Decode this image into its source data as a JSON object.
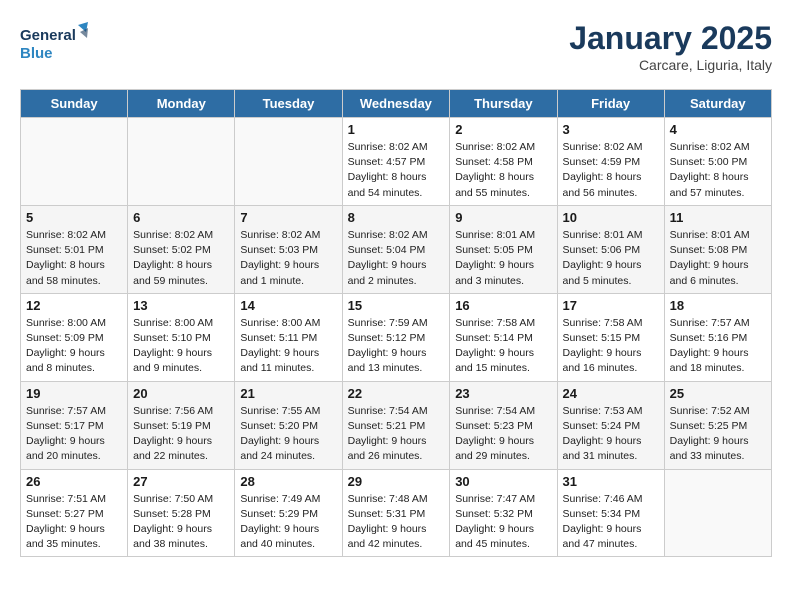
{
  "logo": {
    "line1": "General",
    "line2": "Blue"
  },
  "title": "January 2025",
  "subtitle": "Carcare, Liguria, Italy",
  "weekdays": [
    "Sunday",
    "Monday",
    "Tuesday",
    "Wednesday",
    "Thursday",
    "Friday",
    "Saturday"
  ],
  "weeks": [
    [
      {
        "day": "",
        "info": ""
      },
      {
        "day": "",
        "info": ""
      },
      {
        "day": "",
        "info": ""
      },
      {
        "day": "1",
        "info": "Sunrise: 8:02 AM\nSunset: 4:57 PM\nDaylight: 8 hours\nand 54 minutes."
      },
      {
        "day": "2",
        "info": "Sunrise: 8:02 AM\nSunset: 4:58 PM\nDaylight: 8 hours\nand 55 minutes."
      },
      {
        "day": "3",
        "info": "Sunrise: 8:02 AM\nSunset: 4:59 PM\nDaylight: 8 hours\nand 56 minutes."
      },
      {
        "day": "4",
        "info": "Sunrise: 8:02 AM\nSunset: 5:00 PM\nDaylight: 8 hours\nand 57 minutes."
      }
    ],
    [
      {
        "day": "5",
        "info": "Sunrise: 8:02 AM\nSunset: 5:01 PM\nDaylight: 8 hours\nand 58 minutes."
      },
      {
        "day": "6",
        "info": "Sunrise: 8:02 AM\nSunset: 5:02 PM\nDaylight: 8 hours\nand 59 minutes."
      },
      {
        "day": "7",
        "info": "Sunrise: 8:02 AM\nSunset: 5:03 PM\nDaylight: 9 hours\nand 1 minute."
      },
      {
        "day": "8",
        "info": "Sunrise: 8:02 AM\nSunset: 5:04 PM\nDaylight: 9 hours\nand 2 minutes."
      },
      {
        "day": "9",
        "info": "Sunrise: 8:01 AM\nSunset: 5:05 PM\nDaylight: 9 hours\nand 3 minutes."
      },
      {
        "day": "10",
        "info": "Sunrise: 8:01 AM\nSunset: 5:06 PM\nDaylight: 9 hours\nand 5 minutes."
      },
      {
        "day": "11",
        "info": "Sunrise: 8:01 AM\nSunset: 5:08 PM\nDaylight: 9 hours\nand 6 minutes."
      }
    ],
    [
      {
        "day": "12",
        "info": "Sunrise: 8:00 AM\nSunset: 5:09 PM\nDaylight: 9 hours\nand 8 minutes."
      },
      {
        "day": "13",
        "info": "Sunrise: 8:00 AM\nSunset: 5:10 PM\nDaylight: 9 hours\nand 9 minutes."
      },
      {
        "day": "14",
        "info": "Sunrise: 8:00 AM\nSunset: 5:11 PM\nDaylight: 9 hours\nand 11 minutes."
      },
      {
        "day": "15",
        "info": "Sunrise: 7:59 AM\nSunset: 5:12 PM\nDaylight: 9 hours\nand 13 minutes."
      },
      {
        "day": "16",
        "info": "Sunrise: 7:58 AM\nSunset: 5:14 PM\nDaylight: 9 hours\nand 15 minutes."
      },
      {
        "day": "17",
        "info": "Sunrise: 7:58 AM\nSunset: 5:15 PM\nDaylight: 9 hours\nand 16 minutes."
      },
      {
        "day": "18",
        "info": "Sunrise: 7:57 AM\nSunset: 5:16 PM\nDaylight: 9 hours\nand 18 minutes."
      }
    ],
    [
      {
        "day": "19",
        "info": "Sunrise: 7:57 AM\nSunset: 5:17 PM\nDaylight: 9 hours\nand 20 minutes."
      },
      {
        "day": "20",
        "info": "Sunrise: 7:56 AM\nSunset: 5:19 PM\nDaylight: 9 hours\nand 22 minutes."
      },
      {
        "day": "21",
        "info": "Sunrise: 7:55 AM\nSunset: 5:20 PM\nDaylight: 9 hours\nand 24 minutes."
      },
      {
        "day": "22",
        "info": "Sunrise: 7:54 AM\nSunset: 5:21 PM\nDaylight: 9 hours\nand 26 minutes."
      },
      {
        "day": "23",
        "info": "Sunrise: 7:54 AM\nSunset: 5:23 PM\nDaylight: 9 hours\nand 29 minutes."
      },
      {
        "day": "24",
        "info": "Sunrise: 7:53 AM\nSunset: 5:24 PM\nDaylight: 9 hours\nand 31 minutes."
      },
      {
        "day": "25",
        "info": "Sunrise: 7:52 AM\nSunset: 5:25 PM\nDaylight: 9 hours\nand 33 minutes."
      }
    ],
    [
      {
        "day": "26",
        "info": "Sunrise: 7:51 AM\nSunset: 5:27 PM\nDaylight: 9 hours\nand 35 minutes."
      },
      {
        "day": "27",
        "info": "Sunrise: 7:50 AM\nSunset: 5:28 PM\nDaylight: 9 hours\nand 38 minutes."
      },
      {
        "day": "28",
        "info": "Sunrise: 7:49 AM\nSunset: 5:29 PM\nDaylight: 9 hours\nand 40 minutes."
      },
      {
        "day": "29",
        "info": "Sunrise: 7:48 AM\nSunset: 5:31 PM\nDaylight: 9 hours\nand 42 minutes."
      },
      {
        "day": "30",
        "info": "Sunrise: 7:47 AM\nSunset: 5:32 PM\nDaylight: 9 hours\nand 45 minutes."
      },
      {
        "day": "31",
        "info": "Sunrise: 7:46 AM\nSunset: 5:34 PM\nDaylight: 9 hours\nand 47 minutes."
      },
      {
        "day": "",
        "info": ""
      }
    ]
  ]
}
